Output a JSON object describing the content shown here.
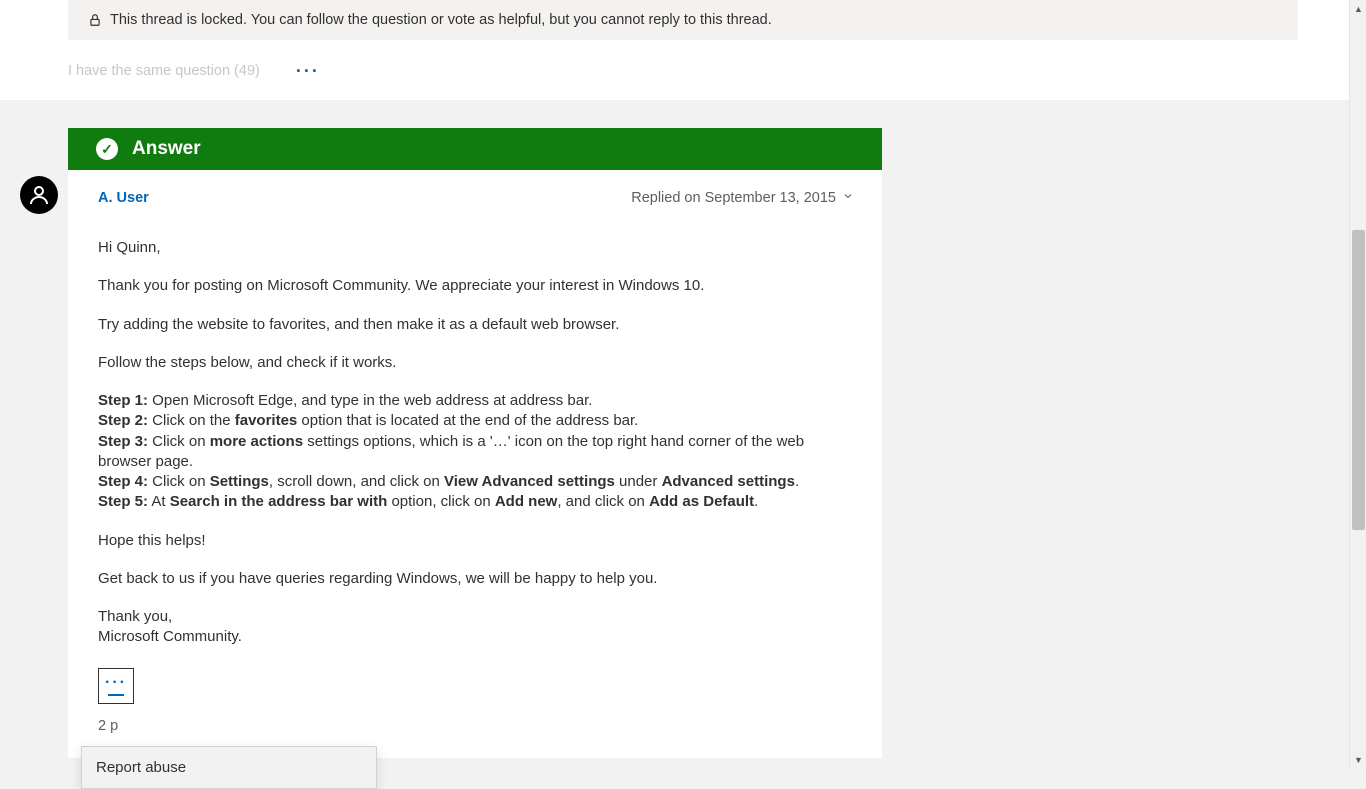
{
  "locked_notice": "This thread is locked. You can follow the question or vote as helpful, but you cannot reply to this thread.",
  "same_question": {
    "label": "I have the same question",
    "count": 49
  },
  "answer_banner": "Answer",
  "author": {
    "name": "A. User"
  },
  "replied_on": "Replied on September 13, 2015",
  "post": {
    "greeting": "Hi Quinn,",
    "thanks": "Thank you for posting on Microsoft Community. We appreciate your interest in Windows 10.",
    "advice": "Try adding the website to favorites, and then make it as a default web browser.",
    "follow": "Follow the steps below, and check if it works.",
    "s1_label": "Step 1:",
    "s1_text": " Open Microsoft Edge, and type in the web address at address bar.",
    "s2_label": "Step 2:",
    "s2_a": " Click on the ",
    "s2_b": "favorites",
    "s2_c": " option that is located at the end of the address bar.",
    "s3_label": "Step 3:",
    "s3_a": " Click on ",
    "s3_b": "more actions",
    "s3_c": " settings options, which is a '…' icon on the top right hand corner of the web browser page.",
    "s4_label": "Step 4:",
    "s4_a": " Click on ",
    "s4_b": "Settings",
    "s4_c": ", scroll down, and click on ",
    "s4_d": "View Advanced settings",
    "s4_e": " under ",
    "s4_f": "Advanced settings",
    "s4_g": ".",
    "s5_label": "Step 5:",
    "s5_a": " At ",
    "s5_b": "Search in the address bar with",
    "s5_c": " option, click on ",
    "s5_d": "Add new",
    "s5_e": ", and click on ",
    "s5_f": "Add as Default",
    "s5_g": ".",
    "hope": "Hope this helps!",
    "getback": "Get back to us if you have queries regarding Windows, we will be happy to help you.",
    "signoff1": "Thank you,",
    "signoff2": "Microsoft Community."
  },
  "helpful_partial": "2 p",
  "popup": {
    "report_abuse": "Report abuse"
  }
}
